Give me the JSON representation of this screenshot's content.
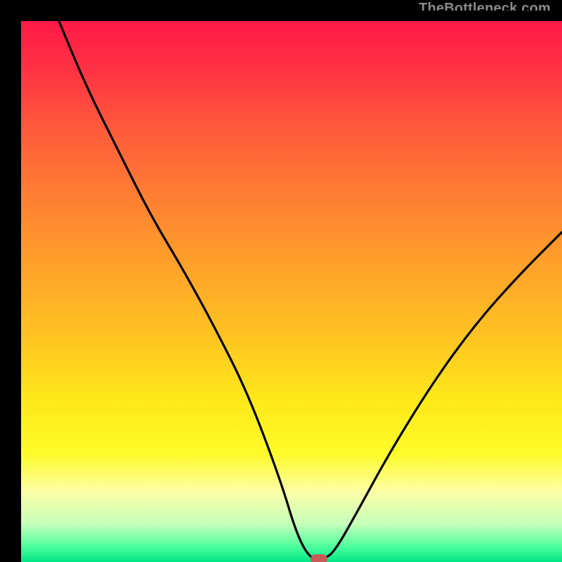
{
  "watermark": "TheBottleneck.com",
  "colors": {
    "background": "#000000",
    "curve": "#000000",
    "marker": "#c85a5a",
    "watermark": "#8a8a8a"
  },
  "chart_data": {
    "type": "line",
    "title": "",
    "xlabel": "",
    "ylabel": "",
    "xlim": [
      0,
      100
    ],
    "ylim": [
      0,
      100
    ],
    "grid": false,
    "series": [
      {
        "name": "bottleneck-curve",
        "x": [
          7,
          12,
          18,
          24,
          30,
          36,
          42,
          48,
          51,
          53.5,
          56,
          58,
          62,
          68,
          76,
          84,
          92,
          100
        ],
        "values": [
          100,
          88,
          76,
          64,
          54,
          43,
          31,
          15,
          5,
          0.5,
          0.5,
          2,
          9,
          20,
          33,
          44,
          53,
          61
        ]
      }
    ],
    "marker": {
      "x": 55,
      "y": 0.5
    },
    "gradient_stops": [
      {
        "pos": 0,
        "color": "#ff1a47"
      },
      {
        "pos": 8,
        "color": "#ff2f44"
      },
      {
        "pos": 20,
        "color": "#ff5a3b"
      },
      {
        "pos": 32,
        "color": "#ff7d33"
      },
      {
        "pos": 45,
        "color": "#ffa12a"
      },
      {
        "pos": 58,
        "color": "#ffc322"
      },
      {
        "pos": 70,
        "color": "#ffe81a"
      },
      {
        "pos": 80,
        "color": "#fffb2a"
      },
      {
        "pos": 87,
        "color": "#fcffa7"
      },
      {
        "pos": 93,
        "color": "#c5ffba"
      },
      {
        "pos": 97,
        "color": "#51ff9e"
      },
      {
        "pos": 100,
        "color": "#00e884"
      }
    ]
  }
}
